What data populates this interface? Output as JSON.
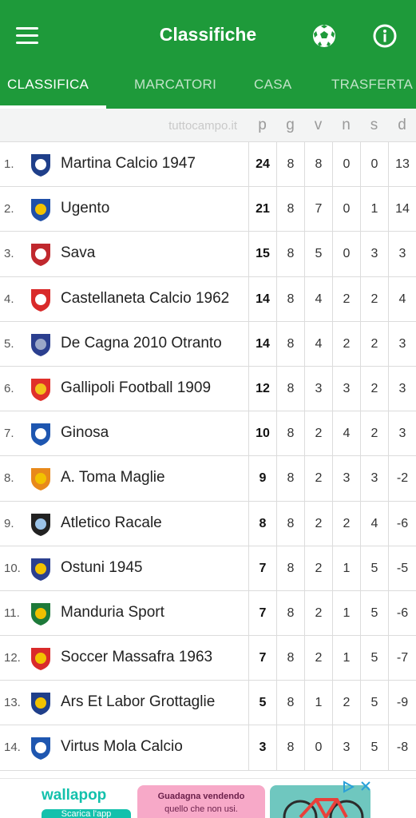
{
  "header": {
    "title": "Classifiche",
    "tabs": [
      {
        "label": "CLASSIFICA",
        "active": true
      },
      {
        "label": "MARCATORI",
        "active": false
      },
      {
        "label": "CASA",
        "active": false
      },
      {
        "label": "TRASFERTA",
        "active": false
      }
    ],
    "icons": [
      "menu-icon",
      "soccer-ball-icon",
      "info-icon"
    ]
  },
  "table": {
    "source": "tuttocampo.it",
    "columns": [
      "p",
      "g",
      "v",
      "n",
      "s",
      "d"
    ],
    "rows": [
      {
        "pos": "1.",
        "team": "Martina Calcio 1947",
        "p": "24",
        "g": "8",
        "v": "8",
        "n": "0",
        "s": "0",
        "d": "13"
      },
      {
        "pos": "2.",
        "team": "Ugento",
        "p": "21",
        "g": "8",
        "v": "7",
        "n": "0",
        "s": "1",
        "d": "14"
      },
      {
        "pos": "3.",
        "team": "Sava",
        "p": "15",
        "g": "8",
        "v": "5",
        "n": "0",
        "s": "3",
        "d": "3"
      },
      {
        "pos": "4.",
        "team": "Castellaneta Calcio 1962",
        "p": "14",
        "g": "8",
        "v": "4",
        "n": "2",
        "s": "2",
        "d": "4"
      },
      {
        "pos": "5.",
        "team": "De Cagna 2010 Otranto",
        "p": "14",
        "g": "8",
        "v": "4",
        "n": "2",
        "s": "2",
        "d": "3"
      },
      {
        "pos": "6.",
        "team": "Gallipoli Football 1909",
        "p": "12",
        "g": "8",
        "v": "3",
        "n": "3",
        "s": "2",
        "d": "3"
      },
      {
        "pos": "7.",
        "team": "Ginosa",
        "p": "10",
        "g": "8",
        "v": "2",
        "n": "4",
        "s": "2",
        "d": "3"
      },
      {
        "pos": "8.",
        "team": "A. Toma Maglie",
        "p": "9",
        "g": "8",
        "v": "2",
        "n": "3",
        "s": "3",
        "d": "-2"
      },
      {
        "pos": "9.",
        "team": "Atletico Racale",
        "p": "8",
        "g": "8",
        "v": "2",
        "n": "2",
        "s": "4",
        "d": "-6"
      },
      {
        "pos": "10.",
        "team": "Ostuni 1945",
        "p": "7",
        "g": "8",
        "v": "2",
        "n": "1",
        "s": "5",
        "d": "-5"
      },
      {
        "pos": "11.",
        "team": "Manduria Sport",
        "p": "7",
        "g": "8",
        "v": "2",
        "n": "1",
        "s": "5",
        "d": "-6"
      },
      {
        "pos": "12.",
        "team": "Soccer Massafra 1963",
        "p": "7",
        "g": "8",
        "v": "2",
        "n": "1",
        "s": "5",
        "d": "-7"
      },
      {
        "pos": "13.",
        "team": "Ars Et Labor Grottaglie",
        "p": "5",
        "g": "8",
        "v": "1",
        "n": "2",
        "s": "5",
        "d": "-9"
      },
      {
        "pos": "14.",
        "team": "Virtus Mola Calcio",
        "p": "3",
        "g": "8",
        "v": "0",
        "n": "3",
        "s": "5",
        "d": "-8"
      }
    ]
  },
  "logo_colors": [
    [
      "#1f3f8a",
      "#ffffff"
    ],
    [
      "#1f4fa8",
      "#f2c200"
    ],
    [
      "#c0282e",
      "#ffffff"
    ],
    [
      "#d92a2a",
      "#ffffff"
    ],
    [
      "#2b3f8f",
      "#9aa7c8"
    ],
    [
      "#e0302a",
      "#f3c21c"
    ],
    [
      "#1e56b0",
      "#ffffff"
    ],
    [
      "#e8891a",
      "#f2c200"
    ],
    [
      "#222222",
      "#9bc3e8"
    ],
    [
      "#2b3f8f",
      "#f2c200"
    ],
    [
      "#1e7a3a",
      "#f0c000"
    ],
    [
      "#d92a2a",
      "#f2c200"
    ],
    [
      "#1f3f8a",
      "#f2c200"
    ],
    [
      "#1e56b0",
      "#ffffff"
    ]
  ],
  "ad": {
    "brand": "wallapop",
    "cta": "Scarica l'app",
    "line1": "Guadagna vendendo",
    "line2": "quello che non usi."
  },
  "colors": {
    "header_bg": "#1e9a3a",
    "ad_brand": "#13c1ac"
  }
}
